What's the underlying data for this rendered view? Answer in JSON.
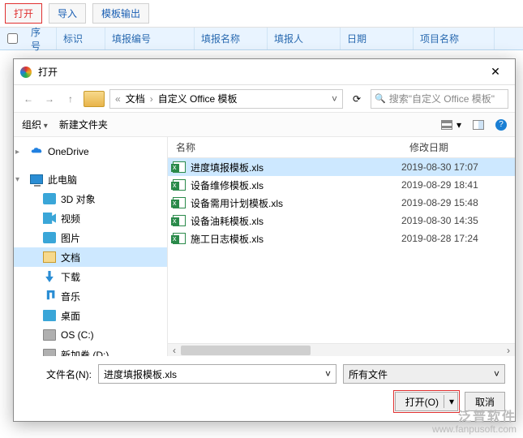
{
  "toolbar": {
    "open": "打开",
    "import": "导入",
    "template": "模板输出"
  },
  "grid": {
    "cols": [
      "序号",
      "标识",
      "填报编号",
      "填报名称",
      "填报人",
      "日期",
      "项目名称"
    ]
  },
  "dialog": {
    "title": "打开",
    "breadcrumb": {
      "a": "文档",
      "b": "自定义 Office 模板"
    },
    "search_placeholder": "搜索\"自定义 Office 模板\"",
    "toolrow": {
      "organize": "组织",
      "newfolder": "新建文件夹"
    },
    "tree": [
      {
        "label": "OneDrive",
        "icon": "ti-cloud",
        "exp": "▸"
      },
      {
        "label": "此电脑",
        "icon": "ti-pc",
        "exp": "▾"
      },
      {
        "label": "3D 对象",
        "icon": "ti-3d",
        "exp": ""
      },
      {
        "label": "视频",
        "icon": "ti-vid",
        "exp": ""
      },
      {
        "label": "图片",
        "icon": "ti-img",
        "exp": ""
      },
      {
        "label": "文档",
        "icon": "ti-doc",
        "exp": "",
        "sel": true
      },
      {
        "label": "下载",
        "icon": "ti-dl",
        "exp": ""
      },
      {
        "label": "音乐",
        "icon": "ti-mus",
        "exp": ""
      },
      {
        "label": "桌面",
        "icon": "ti-desk",
        "exp": ""
      },
      {
        "label": "OS (C:)",
        "icon": "ti-drv",
        "exp": ""
      },
      {
        "label": "新加卷 (D:)",
        "icon": "ti-drv",
        "exp": ""
      }
    ],
    "filehead": {
      "name": "名称",
      "date": "修改日期"
    },
    "files": [
      {
        "name": "进度填报模板.xls",
        "date": "2019-08-30 17:07",
        "sel": true
      },
      {
        "name": "设备维修模板.xls",
        "date": "2019-08-29 18:41"
      },
      {
        "name": "设备需用计划模板.xls",
        "date": "2019-08-29 15:48"
      },
      {
        "name": "设备油耗模板.xls",
        "date": "2019-08-30 14:35"
      },
      {
        "name": "施工日志模板.xls",
        "date": "2019-08-28 17:24"
      }
    ],
    "filename_label": "文件名(N):",
    "filename_value": "进度填报模板.xls",
    "filter": "所有文件",
    "open_btn": "打开(O)",
    "cancel_btn": "取消"
  },
  "watermark": {
    "brand": "泛普软件",
    "url": "www.fanpusoft.com"
  }
}
